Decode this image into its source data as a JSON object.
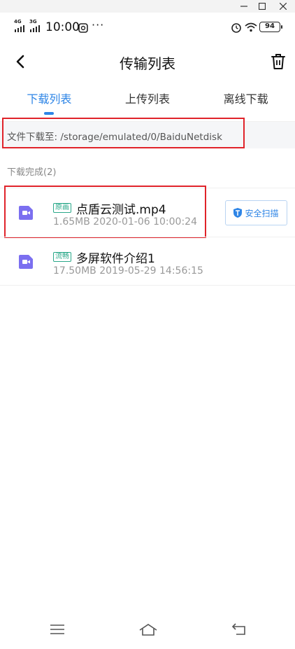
{
  "status_bar": {
    "signal_1": "4G",
    "signal_2": "3G",
    "time": "10:00",
    "dots": "···",
    "battery": "94"
  },
  "header": {
    "title": "传输列表"
  },
  "tabs": [
    {
      "label": "下载列表",
      "active": true
    },
    {
      "label": "上传列表",
      "active": false
    },
    {
      "label": "离线下载",
      "active": false
    }
  ],
  "download_path": "文件下载至: /storage/emulated/0/BaiduNetdisk",
  "section_label": "下载完成(2)",
  "files": [
    {
      "tag": "原画",
      "name": "点盾云测试.mp4",
      "meta": "1.65MB 2020-01-06 10:00:24",
      "action": "安全扫描"
    },
    {
      "tag": "流畅",
      "name": "多屏软件介绍1",
      "meta": "17.50MB 2019-05-29 14:56:15"
    }
  ],
  "colors": {
    "accent": "#2e85e6",
    "tag": "#2aa889",
    "file_icon": "#7b6ff0",
    "highlight": "#e0232a"
  }
}
